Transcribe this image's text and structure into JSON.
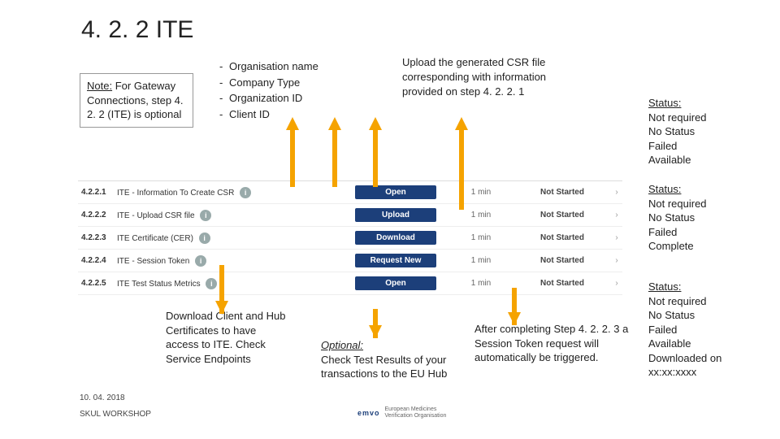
{
  "title": "4. 2. 2 ITE",
  "note": {
    "label": "Note:",
    "body": "For Gateway Connections, step 4. 2. 2 (ITE) is optional"
  },
  "bullets": [
    "Organisation name",
    "Company Type",
    "Organization ID",
    "Client ID"
  ],
  "upload_note": "Upload the generated CSR file corresponding with information provided on step 4. 2. 2. 1",
  "status1": {
    "title": "Status:",
    "lines": [
      "Not required",
      "No Status",
      "Failed",
      "Available"
    ]
  },
  "status2": {
    "title": "Status:",
    "lines": [
      "Not required",
      "No Status",
      "Failed",
      "Complete"
    ]
  },
  "status3": {
    "title": "Status:",
    "lines": [
      "Not required",
      "No Status",
      "Failed",
      "Available",
      "Downloaded on",
      "xx:xx:xxxx"
    ]
  },
  "rows": [
    {
      "num": "4.2.2.1",
      "name": "ITE - Information To Create CSR",
      "btn": "Open",
      "dur": "1 min",
      "stat": "Not Started"
    },
    {
      "num": "4.2.2.2",
      "name": "ITE - Upload CSR file",
      "btn": "Upload",
      "dur": "1 min",
      "stat": "Not Started"
    },
    {
      "num": "4.2.2.3",
      "name": "ITE Certificate (CER)",
      "btn": "Download",
      "dur": "1 min",
      "stat": "Not Started"
    },
    {
      "num": "4.2.2.4",
      "name": "ITE - Session Token",
      "btn": "Request New",
      "dur": "1 min",
      "stat": "Not Started"
    },
    {
      "num": "4.2.2.5",
      "name": "ITE  Test Status Metrics",
      "btn": "Open",
      "dur": "1 min",
      "stat": "Not Started"
    }
  ],
  "download_note": "Download Client and Hub Certificates to have access to ITE. Check Service Endpoints",
  "optional": {
    "label": "Optional:",
    "body": "Check Test Results of your transactions to the EU Hub"
  },
  "after_note": "After completing Step 4. 2. 2. 3 a Session Token request will automatically be triggered.",
  "footer": {
    "date": "10. 04. 2018",
    "workshop": "SKUL WORKSHOP"
  },
  "logo": {
    "mark": "emvo",
    "sub1": "European Medicines",
    "sub2": "Verification Organisation"
  },
  "icon_info": "i",
  "chevron": "›"
}
